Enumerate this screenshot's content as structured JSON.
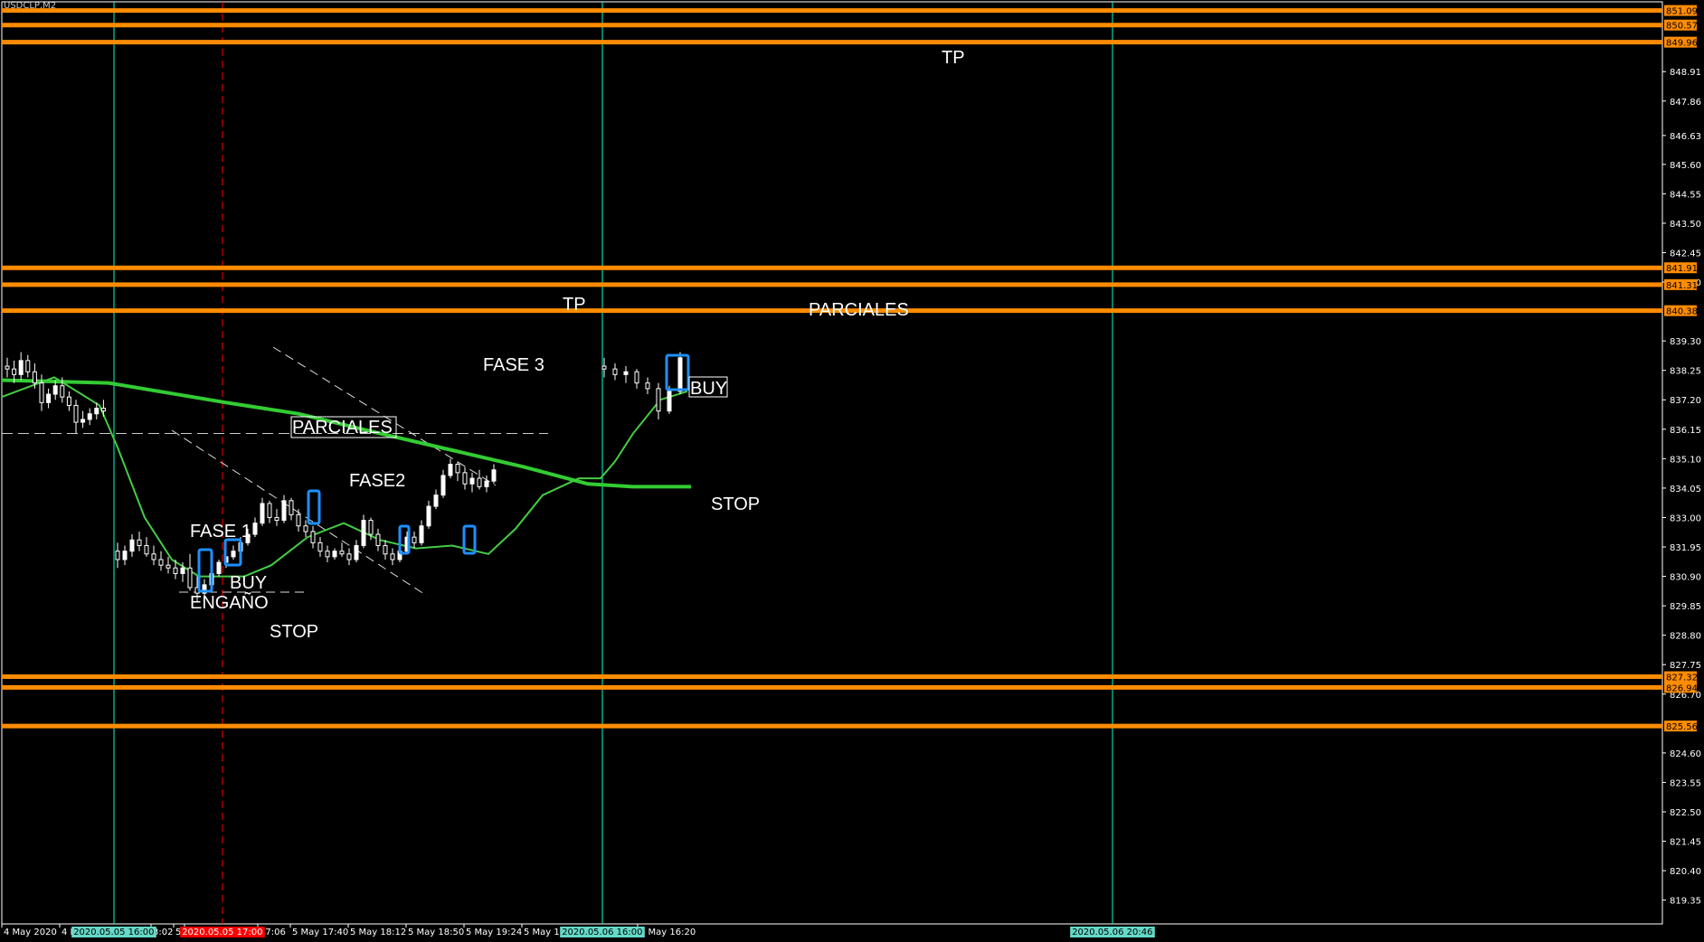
{
  "symbol": "USDCLP,M2",
  "chart_data": {
    "type": "candlestick",
    "y_axis": {
      "range": [
        818.5,
        851.4
      ],
      "ticks": [
        "848.91",
        "847.86",
        "846.63",
        "845.60",
        "844.55",
        "843.50",
        "842.45",
        "841.40",
        "839.30",
        "838.25",
        "837.20",
        "836.15",
        "835.10",
        "834.05",
        "833.00",
        "831.95",
        "830.90",
        "829.85",
        "828.80",
        "827.75",
        "826.70",
        "824.60",
        "823.55",
        "822.50",
        "821.45",
        "820.40",
        "819.35"
      ]
    },
    "x_axis": {
      "ticks": [
        "4 May 2020",
        "4 Ma",
        "5 M",
        "3:02",
        "5 M",
        "17:06",
        "5 May 17:40",
        "5 May 18:12",
        "5 May 18:50",
        "5 May 19:24",
        "5 May 19:5",
        "6 May 16:20"
      ]
    },
    "time_markers": [
      {
        "label": "2020.05.05 16:00",
        "color": "#00ffcc",
        "style": "solid"
      },
      {
        "label": "2020.05.05 17:00",
        "color": "#ff0000",
        "style": "dashed"
      },
      {
        "label": "2020.05.06 16:00",
        "color": "#00ffcc",
        "style": "solid"
      },
      {
        "label": "2020.05.06 20:46",
        "color": "#00ffcc",
        "style": "solid"
      }
    ],
    "horizontal_levels": [
      {
        "price": 851.09,
        "label": "851.09"
      },
      {
        "price": 850.57,
        "label": "850.57"
      },
      {
        "price": 849.96,
        "label": "849.96"
      },
      {
        "price": 841.91,
        "label": "841.91"
      },
      {
        "price": 841.31,
        "label": "841.31"
      },
      {
        "price": 840.38,
        "label": "840.38"
      },
      {
        "price": 827.32,
        "label": "827.32"
      },
      {
        "price": 826.94,
        "label": "826.94"
      },
      {
        "price": 825.56,
        "label": "825.56"
      }
    ],
    "level_color": "#ff8c00",
    "dashed_level": 836.0,
    "candles": [
      [
        838.4,
        838.7,
        838.0,
        838.3
      ],
      [
        838.3,
        838.6,
        837.8,
        838.1
      ],
      [
        838.1,
        838.9,
        837.9,
        838.6
      ],
      [
        838.6,
        838.8,
        838.0,
        838.2
      ],
      [
        838.2,
        838.5,
        837.6,
        837.8
      ],
      [
        837.8,
        838.1,
        836.8,
        837.1
      ],
      [
        837.1,
        837.6,
        836.9,
        837.4
      ],
      [
        837.4,
        837.9,
        837.2,
        837.7
      ],
      [
        837.7,
        838.0,
        837.1,
        837.3
      ],
      [
        837.3,
        837.5,
        836.8,
        837.0
      ],
      [
        837.0,
        837.2,
        836.0,
        836.4
      ],
      [
        836.4,
        836.8,
        836.2,
        836.5
      ],
      [
        836.5,
        836.9,
        836.3,
        836.7
      ],
      [
        836.7,
        837.1,
        836.5,
        836.9
      ],
      [
        836.9,
        837.2,
        836.6,
        836.8
      ],
      [
        831.8,
        832.1,
        831.2,
        831.5
      ],
      [
        831.5,
        832.0,
        831.3,
        831.8
      ],
      [
        831.8,
        832.4,
        831.6,
        832.2
      ],
      [
        832.2,
        832.5,
        831.8,
        832.0
      ],
      [
        832.0,
        832.3,
        831.6,
        831.7
      ],
      [
        831.7,
        832.0,
        831.3,
        831.5
      ],
      [
        831.5,
        831.8,
        831.1,
        831.3
      ],
      [
        831.3,
        831.6,
        831.0,
        831.2
      ],
      [
        831.2,
        831.5,
        830.8,
        831.0
      ],
      [
        831.0,
        831.4,
        830.7,
        831.2
      ],
      [
        831.2,
        831.7,
        830.4,
        830.5
      ],
      [
        830.5,
        830.9,
        830.0,
        830.3
      ],
      [
        830.3,
        830.8,
        830.0,
        830.6
      ],
      [
        830.6,
        831.2,
        830.5,
        831.0
      ],
      [
        831.0,
        831.5,
        830.9,
        831.4
      ],
      [
        831.4,
        831.8,
        831.2,
        831.6
      ],
      [
        831.6,
        832.0,
        831.5,
        831.8
      ],
      [
        831.8,
        832.3,
        831.7,
        832.1
      ],
      [
        832.1,
        832.6,
        832.0,
        832.4
      ],
      [
        832.4,
        833.0,
        832.3,
        832.8
      ],
      [
        832.8,
        833.7,
        832.7,
        833.5
      ],
      [
        833.5,
        833.6,
        832.8,
        833.0
      ],
      [
        833.0,
        833.3,
        832.7,
        832.9
      ],
      [
        832.9,
        833.8,
        832.8,
        833.6
      ],
      [
        833.6,
        833.7,
        832.9,
        833.1
      ],
      [
        833.1,
        833.3,
        832.5,
        832.7
      ],
      [
        832.7,
        832.9,
        832.3,
        832.5
      ],
      [
        832.5,
        832.7,
        831.9,
        832.1
      ],
      [
        832.1,
        832.3,
        831.6,
        831.8
      ],
      [
        831.8,
        832.0,
        831.4,
        831.6
      ],
      [
        831.6,
        831.9,
        831.5,
        831.8
      ],
      [
        831.8,
        832.1,
        831.6,
        831.7
      ],
      [
        831.7,
        831.9,
        831.3,
        831.5
      ],
      [
        831.5,
        832.2,
        831.4,
        832.0
      ],
      [
        832.0,
        833.1,
        831.9,
        832.9
      ],
      [
        832.9,
        833.0,
        832.2,
        832.4
      ],
      [
        832.4,
        832.6,
        831.8,
        832.0
      ],
      [
        832.0,
        832.2,
        831.5,
        831.7
      ],
      [
        831.7,
        831.9,
        831.3,
        831.5
      ],
      [
        831.5,
        831.9,
        831.4,
        831.8
      ],
      [
        831.8,
        832.5,
        831.7,
        832.3
      ],
      [
        832.3,
        832.5,
        831.9,
        832.1
      ],
      [
        832.1,
        832.9,
        832.0,
        832.7
      ],
      [
        832.7,
        833.6,
        832.6,
        833.4
      ],
      [
        833.4,
        834.0,
        833.3,
        833.8
      ],
      [
        833.8,
        834.7,
        833.7,
        834.5
      ],
      [
        834.5,
        835.1,
        834.4,
        834.9
      ],
      [
        834.9,
        835.0,
        834.3,
        834.6
      ],
      [
        834.6,
        834.8,
        834.0,
        834.2
      ],
      [
        834.2,
        834.6,
        833.9,
        834.4
      ],
      [
        834.4,
        834.7,
        834.0,
        834.1
      ],
      [
        834.1,
        834.5,
        833.9,
        834.3
      ],
      [
        834.3,
        834.9,
        834.2,
        834.7
      ],
      [
        838.4,
        838.7,
        838.0,
        838.3
      ],
      [
        838.3,
        838.5,
        837.9,
        838.1
      ],
      [
        838.1,
        838.4,
        837.8,
        838.2
      ],
      [
        838.2,
        838.3,
        837.6,
        837.8
      ],
      [
        837.8,
        838.0,
        837.4,
        837.6
      ],
      [
        837.6,
        837.8,
        836.5,
        836.8
      ],
      [
        836.8,
        837.7,
        836.7,
        837.5
      ],
      [
        837.5,
        838.9,
        837.4,
        838.7
      ]
    ],
    "ma_fast_color": "#44cc44",
    "ma_slow_color": "#33cc33",
    "highlight_color": "#1e90ff",
    "trend_line_color": "#dddddd"
  },
  "annotations": {
    "tp_top": "TP",
    "tp_mid": "TP",
    "parciales_right": "PARCIALES",
    "parciales_boxed": "PARCIALES",
    "fase3": "FASE 3",
    "buy_right": "BUY",
    "fase2": "FASE2",
    "stop_right": "STOP",
    "fase1": "FASE 1",
    "buy_left": "BUY",
    "engano": "ENGAÑO",
    "stop_left": "STOP"
  }
}
